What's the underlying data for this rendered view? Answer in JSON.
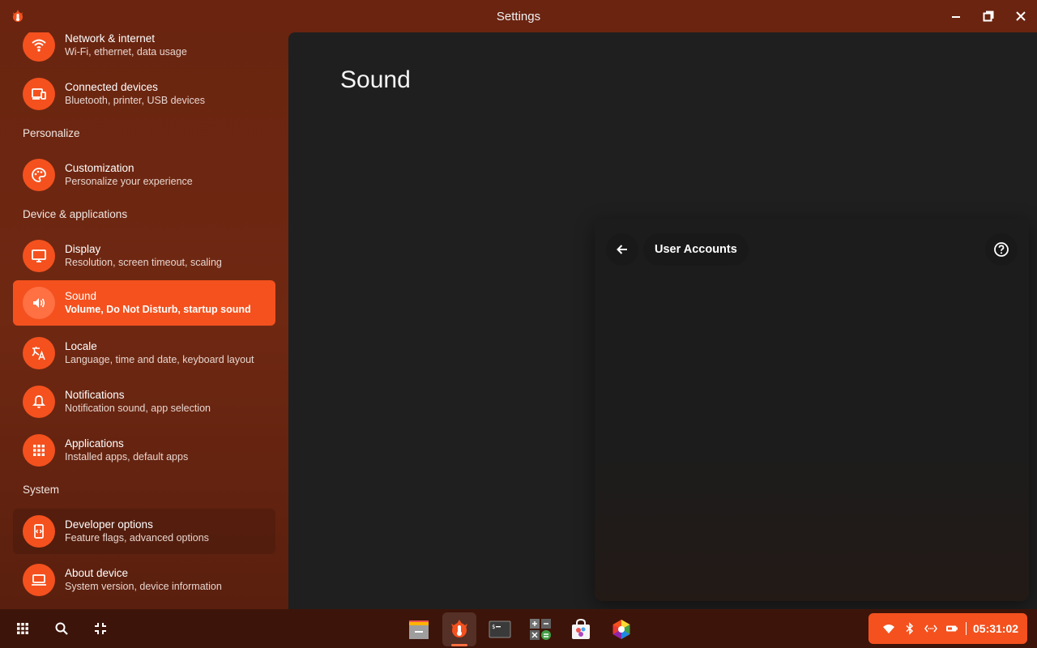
{
  "window": {
    "title": "Settings",
    "icons": {
      "app": "settings-app-icon",
      "minimize": "minimize-icon",
      "maximize": "restore-icon",
      "close": "close-icon"
    }
  },
  "sidebar": {
    "items": [
      {
        "title": "Network & internet",
        "subtitle": "Wi-Fi, ethernet, data usage",
        "icon": "wifi-icon"
      },
      {
        "title": "Connected devices",
        "subtitle": "Bluetooth, printer, USB devices",
        "icon": "devices-icon"
      },
      {
        "title": "Customization",
        "subtitle": "Personalize your experience",
        "icon": "palette-icon"
      },
      {
        "title": "Display",
        "subtitle": "Resolution, screen timeout, scaling",
        "icon": "monitor-icon"
      },
      {
        "title": "Sound",
        "subtitle": "Volume, Do Not Disturb, startup sound",
        "icon": "volume-icon",
        "selected": true
      },
      {
        "title": "Locale",
        "subtitle": "Language, time and date, keyboard layout",
        "icon": "translate-icon"
      },
      {
        "title": "Notifications",
        "subtitle": "Notification sound, app selection",
        "icon": "bell-icon"
      },
      {
        "title": "Applications",
        "subtitle": "Installed apps, default apps",
        "icon": "apps-grid-icon"
      },
      {
        "title": "Developer options",
        "subtitle": "Feature flags, advanced options",
        "icon": "developer-icon"
      },
      {
        "title": "About device",
        "subtitle": "System version, device information",
        "icon": "laptop-icon"
      }
    ],
    "sections": {
      "personalize": "Personalize",
      "device": "Device & applications",
      "system": "System"
    }
  },
  "main": {
    "page_title": "Sound"
  },
  "dialog": {
    "title": "User Accounts",
    "back_icon": "arrow-back-icon",
    "help_icon": "help-icon"
  },
  "taskbar": {
    "left": [
      "apps-grid-icon",
      "search-icon",
      "overview-icon"
    ],
    "apps": [
      {
        "name": "Files",
        "icon": "files-app-icon"
      },
      {
        "name": "Settings",
        "icon": "settings-app-icon",
        "active": true
      },
      {
        "name": "Terminal",
        "icon": "terminal-app-icon"
      },
      {
        "name": "Calculator",
        "icon": "calculator-app-icon"
      },
      {
        "name": "Store",
        "icon": "store-app-icon"
      },
      {
        "name": "Color picker",
        "icon": "color-app-icon"
      }
    ],
    "tray": {
      "icons": [
        "wifi-icon",
        "bluetooth-icon",
        "network-code-icon",
        "battery-icon"
      ],
      "clock": "05:31:02"
    }
  },
  "colors": {
    "accent": "#f4511e",
    "sidebar_bg": "#6a2510",
    "main_bg": "#1f1f1f",
    "taskbar_bg": "#3d1409"
  }
}
